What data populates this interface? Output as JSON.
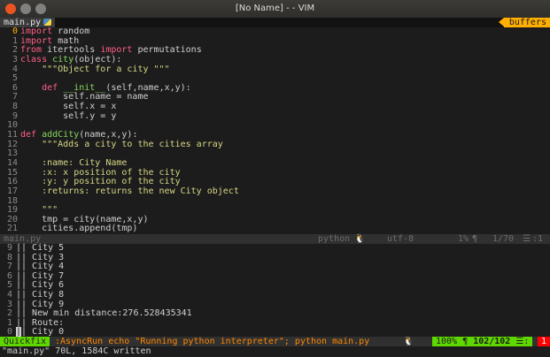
{
  "window": {
    "title": "[No Name] - - VIM"
  },
  "tabline": {
    "file": "main.py",
    "buffers_label": "buffers"
  },
  "editor": {
    "lines": [
      {
        "n": "0",
        "t": "import random"
      },
      {
        "n": "1",
        "t": "import math"
      },
      {
        "n": "2",
        "t": "from itertools import permutations"
      },
      {
        "n": "3",
        "t": "class city(object):"
      },
      {
        "n": "4",
        "t": "    \"\"\"Object for a city \"\"\""
      },
      {
        "n": "5",
        "t": ""
      },
      {
        "n": "6",
        "t": "    def __init__(self,name,x,y):"
      },
      {
        "n": "7",
        "t": "        self.name = name"
      },
      {
        "n": "8",
        "t": "        self.x = x"
      },
      {
        "n": "9",
        "t": "        self.y = y"
      },
      {
        "n": "10",
        "t": ""
      },
      {
        "n": "11",
        "t": "def addCity(name,x,y):"
      },
      {
        "n": "12",
        "t": "    \"\"\"Adds a city to the cities array"
      },
      {
        "n": "13",
        "t": ""
      },
      {
        "n": "14",
        "t": "    :name: City Name"
      },
      {
        "n": "15",
        "t": "    :x: x position of the city"
      },
      {
        "n": "16",
        "t": "    :y: y position of the city"
      },
      {
        "n": "17",
        "t": "    :returns: returns the new City object"
      },
      {
        "n": "18",
        "t": ""
      },
      {
        "n": "19",
        "t": "    \"\"\""
      },
      {
        "n": "20",
        "t": "    tmp = city(name,x,y)"
      },
      {
        "n": "21",
        "t": "    cities.append(tmp)"
      }
    ]
  },
  "statusline_top": {
    "file": "main.py",
    "filetype": "python",
    "encoding": "utf-8",
    "percent": "1%",
    "position": "1/70",
    "col": "1"
  },
  "quickfix": {
    "lines": [
      {
        "n": "9",
        "t": "|| City 5"
      },
      {
        "n": "8",
        "t": "|| City 3"
      },
      {
        "n": "7",
        "t": "|| City 4"
      },
      {
        "n": "6",
        "t": "|| City 7"
      },
      {
        "n": "5",
        "t": "|| City 6"
      },
      {
        "n": "4",
        "t": "|| City 8"
      },
      {
        "n": "3",
        "t": "|| City 9"
      },
      {
        "n": "2",
        "t": "|| New min distance:276.528435341"
      },
      {
        "n": "1",
        "t": "|| Route:"
      },
      {
        "n": "0",
        "t": "|| City 0"
      }
    ]
  },
  "statusline_bottom": {
    "mode": "Quickfix",
    "command": ":AsyncRun echo \"Running python interpreter\"; python main.py",
    "percent": "100%",
    "position": "102/102",
    "col": "1"
  },
  "cmdline": {
    "message": "\"main.py\" 70L, 1584C written"
  },
  "colors": {
    "accent": "#ffaf00",
    "mode": "#5fd700",
    "error": "#ff0000",
    "close": "#e95420"
  }
}
